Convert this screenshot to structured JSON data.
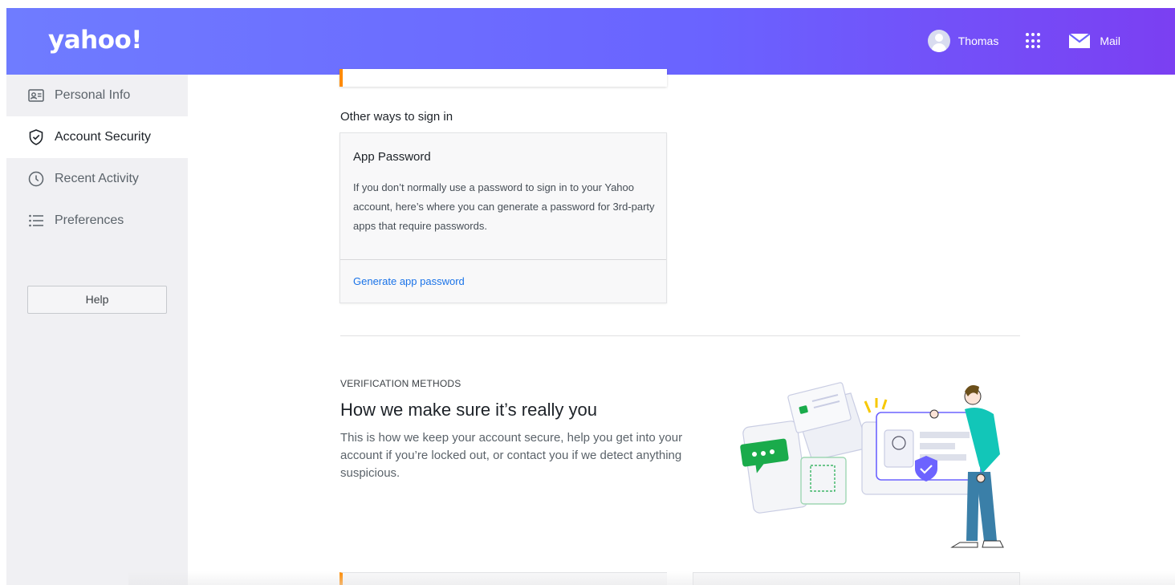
{
  "header": {
    "logo": "yahoo!",
    "user_name": "Thomas",
    "mail_label": "Mail",
    "colors": {
      "gradient_start": "#6f7cff",
      "gradient_end": "#7b3ff2"
    }
  },
  "sidebar": {
    "items": [
      {
        "label": "Personal Info",
        "icon": "id-card-icon",
        "active": false
      },
      {
        "label": "Account Security",
        "icon": "shield-check-icon",
        "active": true
      },
      {
        "label": "Recent Activity",
        "icon": "clock-icon",
        "active": false
      },
      {
        "label": "Preferences",
        "icon": "list-icon",
        "active": false
      }
    ],
    "help_label": "Help"
  },
  "main": {
    "other_ways_label": "Other ways to sign in",
    "app_password": {
      "title": "App Password",
      "description": "If you don’t normally use a password to sign in to your Yahoo account, here’s where you can generate a password for 3rd-party apps that require passwords.",
      "link_label": "Generate app password"
    },
    "verification": {
      "eyebrow": "VERIFICATION METHODS",
      "title": "How we make sure it’s really you",
      "description": "This is how we keep your account secure, help you get into your account if you’re locked out, or contact you if we detect anything suspicious."
    },
    "accent_color": "#ff8a00",
    "link_color": "#1a73e8"
  }
}
